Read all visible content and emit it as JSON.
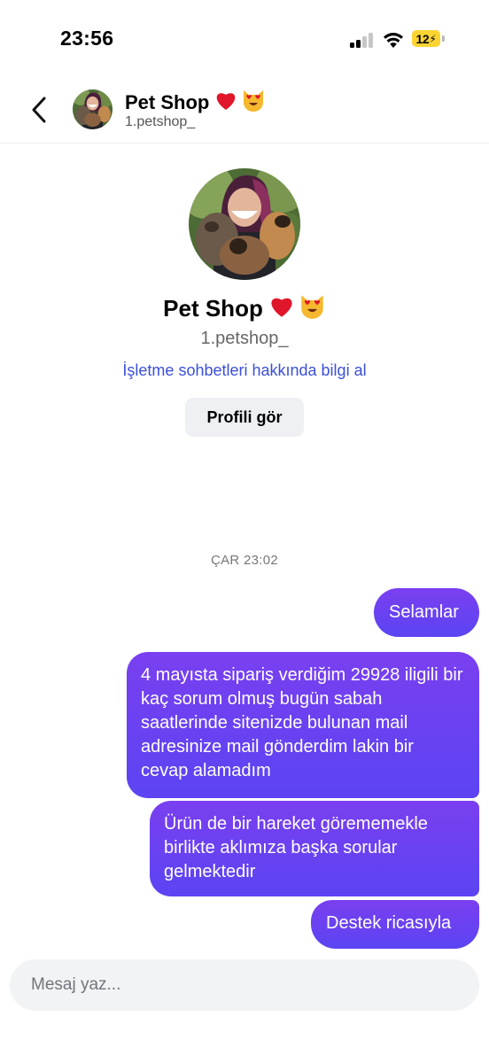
{
  "status_bar": {
    "time": "23:56",
    "battery_level": "12",
    "icons": [
      "signal-icon",
      "wifi-icon",
      "battery-charging-icon"
    ]
  },
  "header": {
    "name": "Pet Shop",
    "name_emojis": [
      "heart-icon",
      "heart-eyes-cat-icon"
    ],
    "handle": "1.petshop_"
  },
  "profile": {
    "name": "Pet Shop",
    "handle": "1.petshop_",
    "info_link": "İşletme sohbetleri hakkında bilgi al",
    "view_profile_button": "Profili gör"
  },
  "conversation": {
    "timestamp": "ÇAR 23:02",
    "messages": [
      {
        "sender": "me",
        "text": "Selamlar"
      },
      {
        "sender": "me",
        "text": "4 mayısta sipariş verdiğim 29928 iligili bir kaç sorum olmuş bugün sabah saatlerinde sitenizde bulunan mail adresinize mail gönderdim lakin bir cevap alamadım"
      },
      {
        "sender": "me",
        "text": "Ürün de bir hareket görememekle birlikte aklımıza başka sorular gelmektedir"
      },
      {
        "sender": "me",
        "text": "Destek ricasıyla"
      }
    ]
  },
  "composer": {
    "placeholder": "Mesaj yaz..."
  },
  "colors": {
    "bubble_top": "#7a3ff0",
    "bubble_bottom": "#5b44f2",
    "link": "#3a4fd9",
    "battery": "#fbd433"
  }
}
